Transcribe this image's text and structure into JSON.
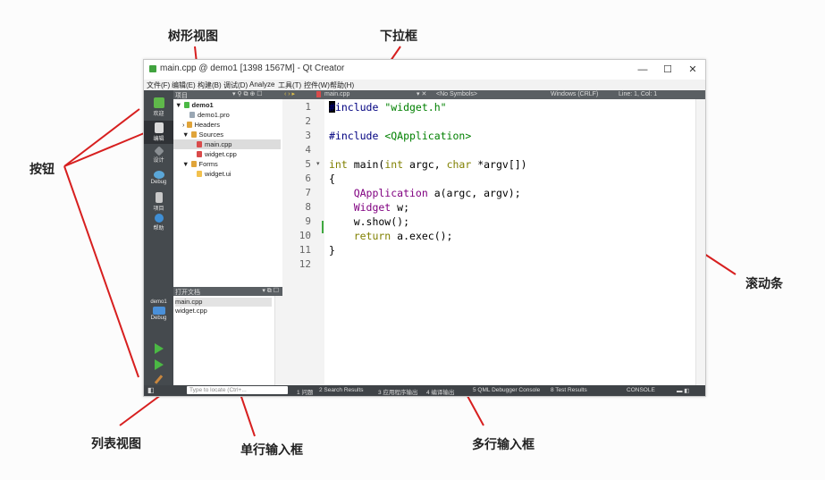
{
  "annotations": {
    "tree_view": "树形视图",
    "dropdown": "下拉框",
    "button": "按钮",
    "scrollbar": "滚动条",
    "list_view": "列表视图",
    "single_line_input": "单行输入框",
    "multi_line_input": "多行输入框"
  },
  "window": {
    "title": "main.cpp @ demo1 [1398 1567M] - Qt Creator",
    "controls": {
      "minimize": "—",
      "maximize": "☐",
      "close": "✕"
    }
  },
  "menu": [
    "文件(F)",
    "编辑(E)",
    "构建(B)",
    "调试(D)",
    "Analyze",
    "工具(T)",
    "控件(W)",
    "帮助(H)"
  ],
  "modes": [
    {
      "label": "欢迎"
    },
    {
      "label": "编辑"
    },
    {
      "label": "设计"
    },
    {
      "label": "Debug"
    },
    {
      "label": "项目"
    },
    {
      "label": "帮助"
    }
  ],
  "kit": {
    "project": "demo1",
    "config": "Debug"
  },
  "project_pane": {
    "header": "项目",
    "tree": [
      {
        "label": "demo1",
        "indent": 0,
        "expander": "▼"
      },
      {
        "label": "demo1.pro",
        "indent": 1,
        "expander": ""
      },
      {
        "label": "Headers",
        "indent": 1,
        "expander": "›"
      },
      {
        "label": "Sources",
        "indent": 1,
        "expander": "▼"
      },
      {
        "label": "main.cpp",
        "indent": 2,
        "expander": "",
        "selected": true
      },
      {
        "label": "widget.cpp",
        "indent": 2,
        "expander": ""
      },
      {
        "label": "Forms",
        "indent": 1,
        "expander": "▼"
      },
      {
        "label": "widget.ui",
        "indent": 2,
        "expander": ""
      }
    ]
  },
  "open_docs": {
    "header": "打开文档",
    "items": [
      {
        "label": "main.cpp",
        "selected": true
      },
      {
        "label": "widget.cpp"
      }
    ]
  },
  "editor": {
    "file_combo": "main.cpp",
    "symbol_combo": "<No Symbols>",
    "encoding": "Windows (CRLF)",
    "position": "Line: 1, Col: 1",
    "lines": [
      [
        [
          "pp",
          "#include "
        ],
        [
          "str",
          "\"widget.h\""
        ]
      ],
      [],
      [
        [
          "pp",
          "#include "
        ],
        [
          "str",
          "<QApplication>"
        ]
      ],
      [],
      [
        [
          "kw",
          "int "
        ],
        [
          "def",
          "main("
        ],
        [
          "kw",
          "int "
        ],
        [
          "def",
          "argc, "
        ],
        [
          "kw",
          "char "
        ],
        [
          "def",
          "*argv[])"
        ]
      ],
      [
        [
          "def",
          "{"
        ]
      ],
      [
        [
          "type",
          "    QApplication "
        ],
        [
          "def",
          "a(argc, argv);"
        ]
      ],
      [
        [
          "type",
          "    Widget "
        ],
        [
          "def",
          "w;"
        ]
      ],
      [
        [
          "def",
          "    w.show();"
        ]
      ],
      [
        [
          "kw",
          "    return "
        ],
        [
          "def",
          "a.exec();"
        ]
      ],
      [
        [
          "def",
          "}"
        ]
      ],
      []
    ],
    "line_numbers": [
      "1",
      "2",
      "3",
      "4",
      "5",
      "6",
      "7",
      "8",
      "9",
      "10",
      "11",
      "12"
    ]
  },
  "statusbar": {
    "locator_placeholder": "Type to locate (Ctrl+...",
    "panes": [
      "1 问题",
      "2 Search Results",
      "3 应用程序输出",
      "4 编译输出",
      "5 QML Debugger Console",
      "8 Test Results"
    ],
    "right": "CONSOLE"
  }
}
